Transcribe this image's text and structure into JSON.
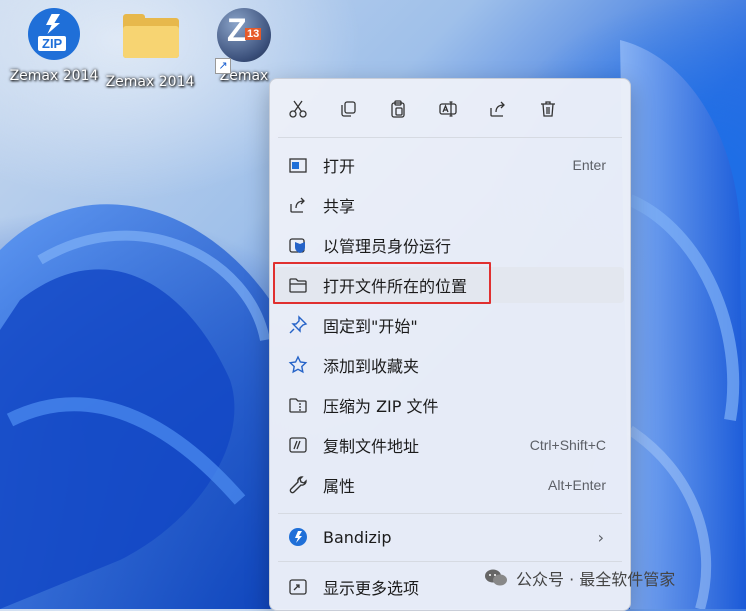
{
  "desktop": {
    "icons": [
      {
        "label": "Zemax 2014",
        "icon": "bandizip-archive-icon"
      },
      {
        "label": "Zemax 2014",
        "icon": "folder-icon"
      },
      {
        "label": "Zemax",
        "icon": "zemax-13-icon",
        "badge": "13",
        "glyph": "Z"
      }
    ],
    "zip_glyph": "ZIP"
  },
  "context_menu": {
    "toolbar": [
      "cut-icon",
      "copy-icon",
      "paste-icon",
      "rename-icon",
      "share-icon",
      "delete-icon"
    ],
    "items": [
      {
        "label": "打开",
        "shortcut": "Enter",
        "icon": "open-icon"
      },
      {
        "label": "共享",
        "shortcut": "",
        "icon": "share-icon"
      },
      {
        "label": "以管理员身份运行",
        "shortcut": "",
        "icon": "admin-shield-icon"
      },
      {
        "label": "打开文件所在的位置",
        "shortcut": "",
        "icon": "folder-icon",
        "highlighted": true
      },
      {
        "label": "固定到\"开始\"",
        "shortcut": "",
        "icon": "pin-icon"
      },
      {
        "label": "添加到收藏夹",
        "shortcut": "",
        "icon": "star-icon"
      },
      {
        "label": "压缩为 ZIP 文件",
        "shortcut": "",
        "icon": "zip-folder-icon"
      },
      {
        "label": "复制文件地址",
        "shortcut": "Ctrl+Shift+C",
        "icon": "copy-path-icon"
      },
      {
        "label": "属性",
        "shortcut": "Alt+Enter",
        "icon": "wrench-icon"
      },
      {
        "label": "Bandizip",
        "shortcut": "",
        "icon": "bandizip-icon",
        "submenu": true,
        "chevron": "›"
      },
      {
        "label": "显示更多选项",
        "shortcut": "",
        "icon": "more-options-icon"
      }
    ]
  },
  "watermark": {
    "text": "公众号 · 最全软件管家"
  },
  "colors": {
    "highlight": "#e03030",
    "accent": "#1f6fd8"
  }
}
